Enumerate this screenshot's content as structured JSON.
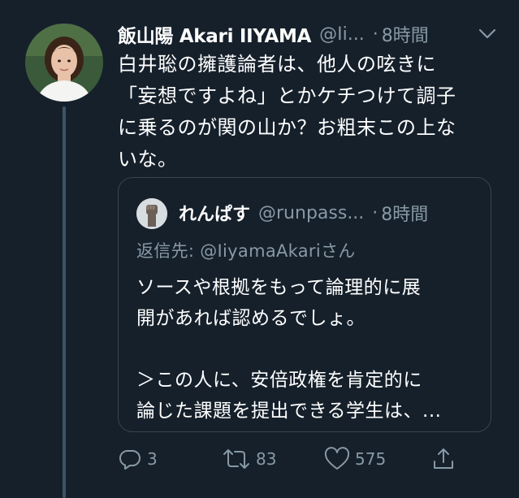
{
  "tweet": {
    "display_name": "飯山陽 Akari IIYAMA",
    "handle": "@Ii...",
    "separator": "·",
    "time": "8時間",
    "avatar_icon": "avatar-photo",
    "more_icon": "chevron-down-icon",
    "text_lines": [
      "白井聡の擁護論者は、他人の呟きに",
      "「妄想ですよね」とかケチつけて調子",
      "に乗るのが関の山か？お粗末この上な",
      "いな。"
    ]
  },
  "quoted_tweet": {
    "display_name": "れんぱす",
    "handle": "@runpass...",
    "separator": "·",
    "time": "8時間",
    "avatar_icon": "raised-fist-avatar",
    "reply_to": "返信先: @IiyamaAkariさん",
    "text_lines": [
      "ソースや根拠をもって論理的に展",
      "開があれば認めるでしょ。",
      "",
      "＞この人に、安倍政権を肯定的に",
      "論じた課題を提出できる学生は、..."
    ]
  },
  "actions": {
    "reply_count": "3",
    "retweet_count": "83",
    "like_count": "575",
    "reply_icon": "reply-icon",
    "retweet_icon": "retweet-icon",
    "like_icon": "heart-icon",
    "share_icon": "share-icon"
  },
  "colors": {
    "background": "#15202b",
    "secondary_text": "#8899a6",
    "border": "#38444d",
    "thread_line": "#3d5466"
  }
}
